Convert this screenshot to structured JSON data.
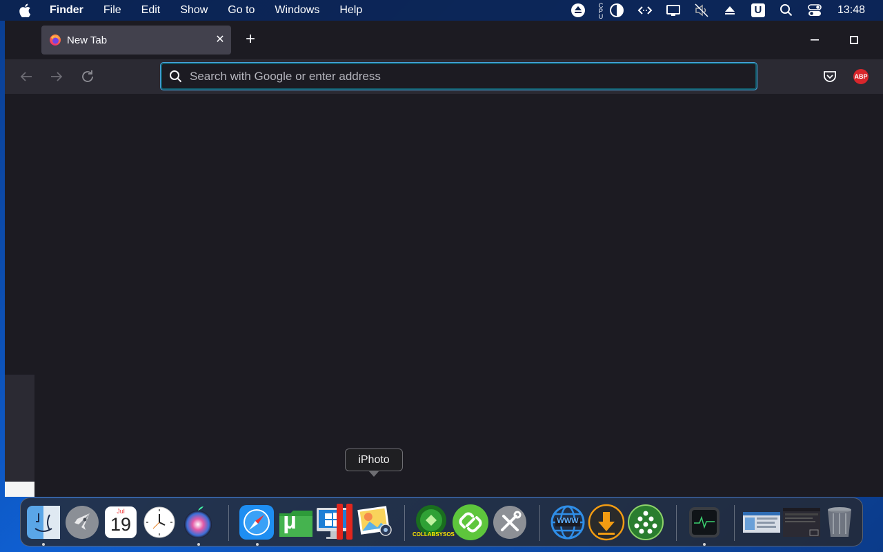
{
  "menubar": {
    "apple_icon": "apple-icon",
    "items": [
      "Finder",
      "File",
      "Edit",
      "Show",
      "Go to",
      "Windows",
      "Help"
    ],
    "clock": "13:48",
    "tray_icons": [
      "eject-icon",
      "cpu-icon",
      "contrast-icon",
      "code-icon",
      "display-icon",
      "mute-icon",
      "upload-icon",
      "u-icon",
      "search-icon",
      "control-center-icon"
    ],
    "cpu_label": "CPU",
    "u_label": "U"
  },
  "browser": {
    "tab": {
      "title": "New Tab",
      "close": "✕"
    },
    "newtab": "+",
    "urlbar": {
      "placeholder": "Search with Google or enter address",
      "value": ""
    },
    "abp_label": "ABP"
  },
  "tooltip": "iPhoto",
  "dock": {
    "calendar": {
      "month": "Jul",
      "day": "19"
    },
    "collabsysos_label": "COLLABSYSOS",
    "www_label": "WWW",
    "utorrent_label": "µ",
    "apps": [
      "Finder",
      "Launchpad",
      "Calendar",
      "Clock",
      "Siri",
      "Safari",
      "uTorrent",
      "Boot Camp",
      "Parallels",
      "iPhoto",
      "CollabSysOS",
      "Link",
      "Utilities",
      "WWW",
      "Downloader",
      "Network",
      "Activity Monitor",
      "Window 1",
      "Window 2",
      "Trash"
    ]
  },
  "colors": {
    "accent": "#4aa3df",
    "window_bg": "#1c1b22",
    "toolbar_bg": "#2b2a33",
    "tab_bg": "#42414d",
    "abp_red": "#d8262c"
  }
}
